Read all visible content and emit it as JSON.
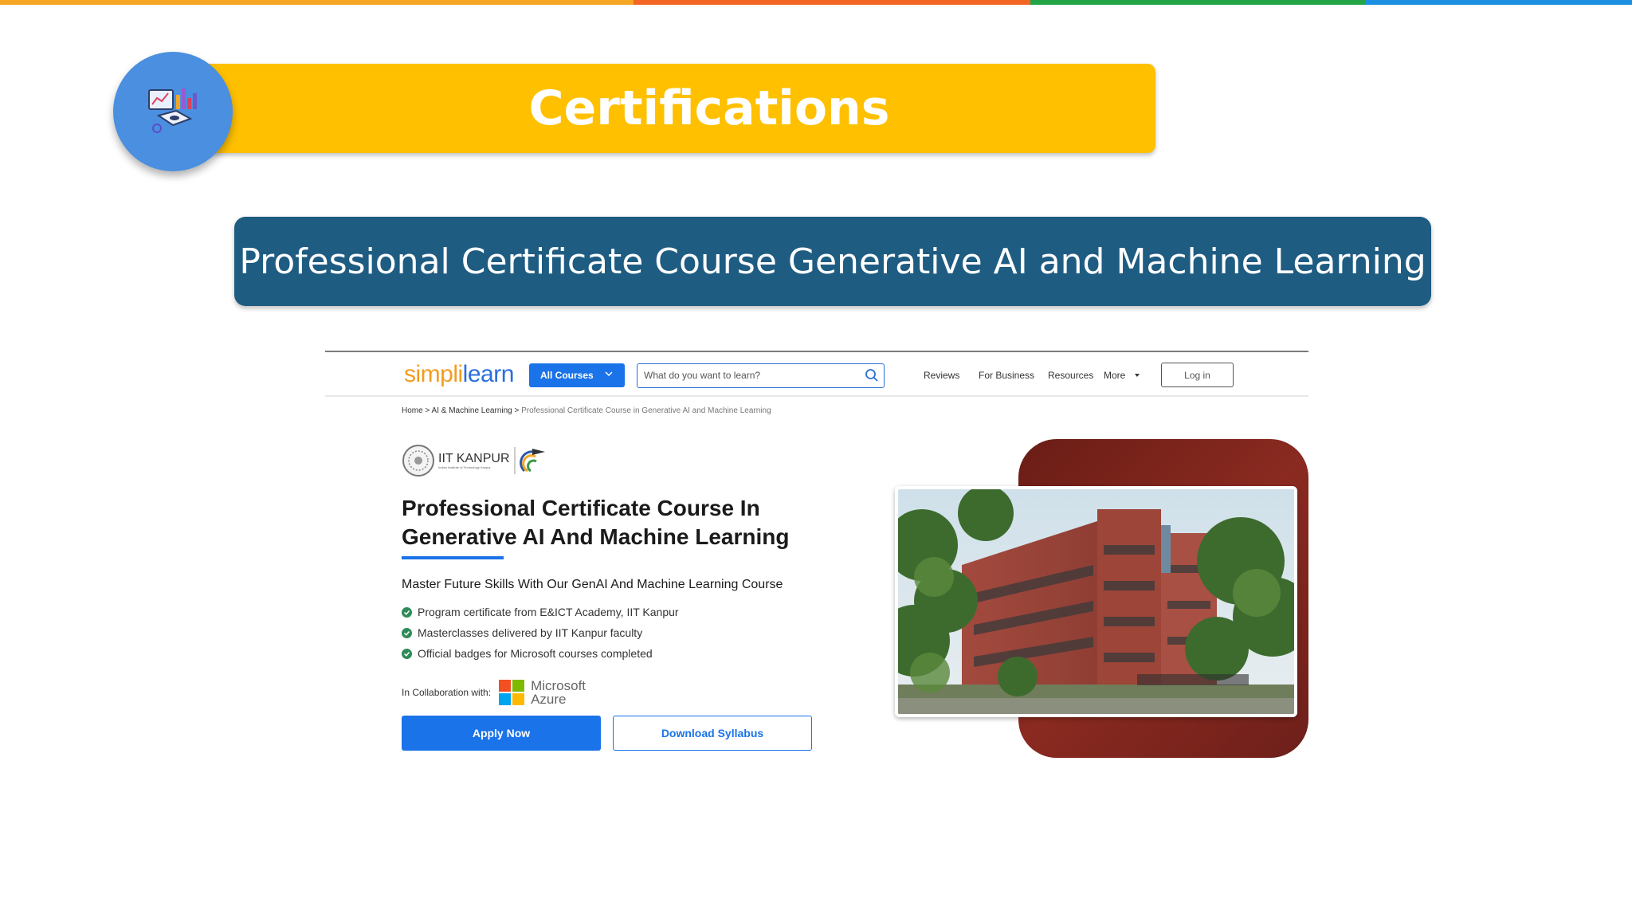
{
  "colors": {
    "stripe": [
      "#f5a623",
      "#f26522",
      "#22a447",
      "#1d8fe0"
    ],
    "title_banner": "#ffc000",
    "title_circle": "#4a8fe0",
    "course_banner": "#1f5c82",
    "primary": "#1a73e8"
  },
  "slide": {
    "title": "Certifications",
    "course_banner": "Professional Certificate Course Generative AI and Machine Learning",
    "title_icon": "analytics-dashboard-icon"
  },
  "site": {
    "logo_part1": "simpli",
    "logo_part2": "learn",
    "all_courses": "All Courses",
    "search_placeholder": "What do you want to learn?",
    "nav": {
      "reviews": "Reviews",
      "for_business": "For Business",
      "resources": "Resources",
      "more": "More"
    },
    "login": "Log in"
  },
  "breadcrumb": {
    "home": "Home",
    "sep": ">",
    "category": "AI & Machine Learning",
    "current": "Professional Certificate Course in Generative AI and Machine Learning"
  },
  "partner": {
    "name": "IIT KANPUR",
    "subtitle": "Indian Institute of Technology Kanpur"
  },
  "course": {
    "title": "Professional Certificate Course In Generative AI And Machine Learning",
    "subtitle": "Master Future Skills With Our GenAI And Machine Learning Course",
    "bullets": [
      "Program certificate from E&ICT Academy, IIT Kanpur",
      "Masterclasses delivered by IIT Kanpur faculty",
      "Official badges for Microsoft courses completed"
    ],
    "collab_label": "In Collaboration with:",
    "collab_partner_line1": "Microsoft",
    "collab_partner_line2": "Azure",
    "apply_label": "Apply Now",
    "download_label": "Download Syllabus"
  }
}
